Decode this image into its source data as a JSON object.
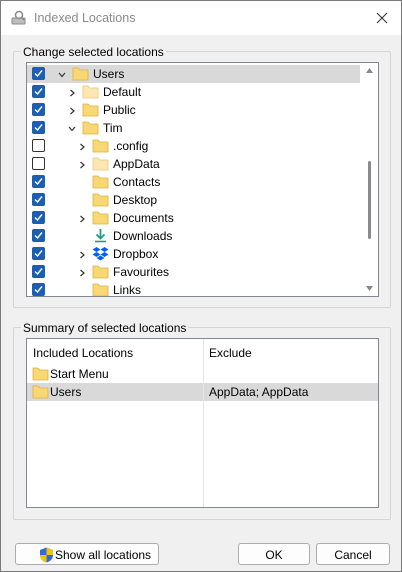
{
  "window": {
    "title": "Indexed Locations",
    "title_icon": "magnifier-drive-icon",
    "close_icon": "close-icon"
  },
  "change_group": {
    "label": "Change selected locations",
    "items": [
      {
        "label": "Users",
        "checked": true,
        "expander": "expanded",
        "icon": "folder",
        "selected": true
      },
      {
        "label": "Default",
        "checked": true,
        "expander": "collapsed",
        "icon": "folder-light"
      },
      {
        "label": "Public",
        "checked": true,
        "expander": "collapsed",
        "icon": "folder"
      },
      {
        "label": "Tim",
        "checked": true,
        "expander": "expanded",
        "icon": "folder"
      },
      {
        "label": ".config",
        "checked": false,
        "expander": "collapsed",
        "icon": "folder"
      },
      {
        "label": "AppData",
        "checked": false,
        "expander": "collapsed",
        "icon": "folder-light"
      },
      {
        "label": "Contacts",
        "checked": true,
        "expander": "none",
        "icon": "folder"
      },
      {
        "label": "Desktop",
        "checked": true,
        "expander": "none",
        "icon": "folder"
      },
      {
        "label": "Documents",
        "checked": true,
        "expander": "collapsed",
        "icon": "folder"
      },
      {
        "label": "Downloads",
        "checked": true,
        "expander": "none",
        "icon": "download"
      },
      {
        "label": "Dropbox",
        "checked": true,
        "expander": "collapsed",
        "icon": "dropbox"
      },
      {
        "label": "Favourites",
        "checked": true,
        "expander": "collapsed",
        "icon": "folder"
      },
      {
        "label": "Links",
        "checked": true,
        "expander": "none",
        "icon": "folder"
      }
    ]
  },
  "summary_group": {
    "label": "Summary of selected locations",
    "columns": {
      "included": "Included Locations",
      "exclude": "Exclude"
    },
    "rows": [
      {
        "included": "Start Menu",
        "exclude": "",
        "selected": false
      },
      {
        "included": "Users",
        "exclude": "AppData; AppData",
        "selected": true
      }
    ]
  },
  "buttons": {
    "show_all": "Show all locations",
    "show_all_icon": "uac-shield-icon",
    "ok": "OK",
    "cancel": "Cancel"
  },
  "colors": {
    "checkbox_accent": "#1a5fb4",
    "folder": "#f8d775",
    "selection": "#d9d9d9"
  }
}
